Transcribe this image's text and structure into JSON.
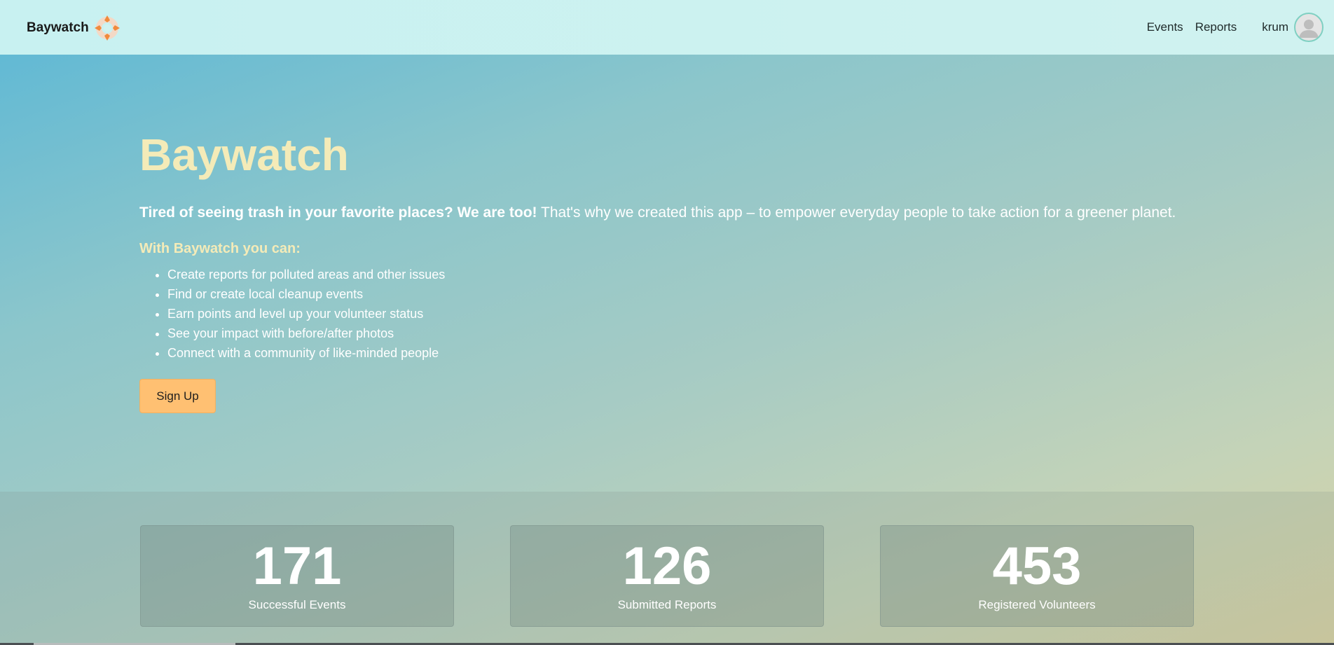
{
  "header": {
    "brand": "Baywatch",
    "logo_icon": "lifebuoy-icon",
    "nav": {
      "events": "Events",
      "reports": "Reports"
    },
    "user": {
      "name": "krum",
      "avatar_icon": "user-avatar-icon"
    }
  },
  "hero": {
    "title": "Baywatch",
    "tagline_bold": "Tired of seeing trash in your favorite places? We are too!",
    "tagline_rest": " That's why we created this app – to empower everyday people to take action for a greener planet.",
    "features_title": "With Baywatch you can:",
    "features": [
      "Create reports for polluted areas and other issues",
      "Find or create local cleanup events",
      "Earn points and level up your volunteer status",
      "See your impact with before/after photos",
      "Connect with a community of like-minded people"
    ],
    "signup_label": "Sign Up"
  },
  "stats": [
    {
      "value": "171",
      "label": "Successful Events"
    },
    {
      "value": "126",
      "label": "Submitted Reports"
    },
    {
      "value": "453",
      "label": "Registered Volunteers"
    }
  ],
  "colors": {
    "accent_yellow": "#f4ebb8",
    "button_orange": "#ffc072",
    "header_bg": "#c8f1f1"
  }
}
